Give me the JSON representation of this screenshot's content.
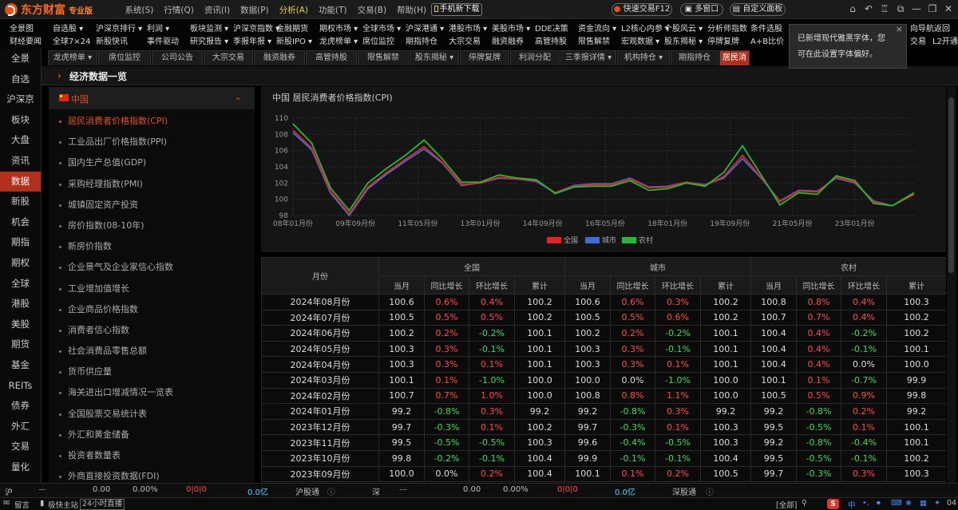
{
  "app": {
    "brand": "东方财富",
    "edition": "专业版"
  },
  "menu": [
    "系统(S)",
    "行情(Q)",
    "资讯(I)",
    "数据(P)",
    "分析(A)",
    "功能(T)",
    "交易(B)",
    "帮助(H)"
  ],
  "menu_active_index": 4,
  "toolbar": {
    "mobile_download": "手机新下载",
    "quick_trade": "快速交易F12",
    "multi_window": "多窗口",
    "custom_panel": "自定义面板"
  },
  "nav_row1": [
    "全景图",
    "自选股 ▾",
    "沪深京排行 ▾",
    "利润 ▾",
    "板块监测 ▾",
    "沪深京指数 ▾",
    "金融期货",
    "期权市场 ▾",
    "全球市场 ▾",
    "沪深港通 ▾",
    "港股市场 ▾",
    "美股市场 ▾",
    "DDE决策",
    "资金流向 ▾",
    "L2核心内参 ▾",
    "个股风云 ▾",
    "分析师指数",
    "条件选股",
    "向导航",
    "返回"
  ],
  "nav_row2": [
    "财经要闻",
    "全球7×24",
    "新股快讯",
    "事件驱动",
    "研究报告 ▾",
    "季报年报 ▾",
    "新股IPO ▾",
    "龙虎榜单 ▾",
    "席位监控",
    "期指持仓",
    "大宗交易",
    "融资融券",
    "高管持股",
    "限售解禁",
    "宏观数据 ▾",
    "股东揭秘 ▾",
    "停牌复牌",
    "A+B比价",
    "交易",
    "L2开通"
  ],
  "sidebar": [
    "全景",
    "自选",
    "沪深京",
    "板块",
    "大盘",
    "资讯",
    "数据",
    "新股",
    "机会",
    "期指",
    "期权",
    "全球",
    "港股",
    "美股",
    "期货",
    "基金",
    "REITs",
    "债券",
    "外汇",
    "交易",
    "量化"
  ],
  "sidebar_active_index": 6,
  "tabs": [
    "龙虎榜单 ▾",
    "席位监控",
    "公司公告",
    "大宗交易",
    "融资融券",
    "高管持股",
    "限售解禁",
    "股东揭秘 ▾",
    "停牌复牌",
    "利润分配",
    "三季报详情 ▾",
    "机构持仓 ▾",
    "期指持仓",
    "居民消"
  ],
  "tabs_active_index": 13,
  "section_title": "经济数据一览",
  "category": {
    "name": "中国"
  },
  "indicators": [
    "居民消费者价格指数(CPI)",
    "工业品出厂价格指数(PPI)",
    "国内生产总值(GDP)",
    "采购经理指数(PMI)",
    "城镇固定资产投资",
    "房价指数(08-10年)",
    "新房价指数",
    "企业景气及企业家信心指数",
    "工业增加值增长",
    "企业商品价格指数",
    "消费者信心指数",
    "社会消费品零售总额",
    "货币供应量",
    "海关进出口增减情况一览表",
    "全国股票交易统计表",
    "外汇和黄金储备",
    "投资者数量表",
    "外商直接投资数据(FDI)"
  ],
  "indicators_active_index": 0,
  "tooltip": {
    "line1": "已新增现代雅黑字体，您",
    "line2": "可在此设置字体偏好。"
  },
  "chart_data": {
    "type": "line",
    "title": "中国 居民消费者价格指数(CPI)",
    "x": [
      "2008-01",
      "2008-07",
      "2009-01",
      "2009-07",
      "2010-01",
      "2010-07",
      "2011-01",
      "2011-07",
      "2012-01",
      "2012-07",
      "2013-01",
      "2013-07",
      "2014-01",
      "2014-07",
      "2015-01",
      "2015-07",
      "2016-01",
      "2016-07",
      "2017-01",
      "2017-07",
      "2018-01",
      "2018-07",
      "2019-01",
      "2019-07",
      "2020-01",
      "2020-07",
      "2021-01",
      "2021-07",
      "2022-01",
      "2022-07",
      "2023-01",
      "2023-07",
      "2024-01",
      "2024-08"
    ],
    "xtick_labels": [
      "08年01月份",
      "09年09月份",
      "11年05月份",
      "13年01月份",
      "14年09月份",
      "16年05月份",
      "18年01月份",
      "19年09月份",
      "21年05月份",
      "23年01月份"
    ],
    "xtick_values": [
      "2008-01",
      "2009-09",
      "2011-05",
      "2013-01",
      "2014-09",
      "2016-05",
      "2018-01",
      "2019-09",
      "2021-05",
      "2023-01"
    ],
    "ylim": [
      98,
      110
    ],
    "yticks": [
      98,
      100,
      102,
      104,
      106,
      108,
      110
    ],
    "grid": true,
    "legend": "bottom",
    "series": [
      {
        "name": "全国",
        "color": "#e8202a",
        "values": [
          108.5,
          106.3,
          101.0,
          98.2,
          101.5,
          103.3,
          104.9,
          106.5,
          104.5,
          101.8,
          102.0,
          102.7,
          102.5,
          102.3,
          100.8,
          101.6,
          101.8,
          101.8,
          102.5,
          101.4,
          101.5,
          102.1,
          101.7,
          102.8,
          105.4,
          102.7,
          99.7,
          101.0,
          100.9,
          102.7,
          102.1,
          99.7,
          99.2,
          100.6
        ]
      },
      {
        "name": "城市",
        "color": "#3a6fd8",
        "values": [
          108.2,
          106.1,
          100.8,
          98.0,
          101.3,
          103.1,
          104.7,
          106.2,
          104.4,
          101.7,
          102.0,
          102.6,
          102.5,
          102.2,
          100.8,
          101.7,
          101.9,
          101.9,
          102.6,
          101.5,
          101.6,
          102.1,
          101.8,
          102.6,
          105.0,
          102.6,
          99.8,
          101.1,
          101.0,
          102.6,
          102.0,
          99.8,
          99.2,
          100.6
        ]
      },
      {
        "name": "农村",
        "color": "#22bb33",
        "values": [
          109.3,
          106.9,
          101.4,
          98.6,
          102.0,
          103.8,
          105.4,
          107.3,
          104.9,
          102.1,
          102.1,
          103.0,
          102.6,
          102.4,
          100.7,
          101.5,
          101.6,
          101.6,
          102.3,
          101.1,
          101.3,
          102.0,
          101.6,
          103.3,
          106.6,
          103.0,
          99.3,
          100.8,
          100.6,
          102.9,
          102.3,
          99.5,
          99.2,
          100.8
        ]
      }
    ]
  },
  "table": {
    "groups": [
      "全国",
      "城市",
      "农村"
    ],
    "month_header": "月份",
    "subcols": [
      "当月",
      "同比增长",
      "环比增长",
      "累计"
    ],
    "rows": [
      [
        "2024年08月份",
        "100.6",
        "0.6%",
        "0.4%",
        "100.2",
        "100.6",
        "0.6%",
        "0.3%",
        "100.2",
        "100.8",
        "0.8%",
        "0.4%",
        "100.3"
      ],
      [
        "2024年07月份",
        "100.5",
        "0.5%",
        "0.5%",
        "100.2",
        "100.5",
        "0.5%",
        "0.6%",
        "100.2",
        "100.7",
        "0.7%",
        "0.4%",
        "100.2"
      ],
      [
        "2024年06月份",
        "100.2",
        "0.2%",
        "-0.2%",
        "100.1",
        "100.2",
        "0.2%",
        "-0.2%",
        "100.1",
        "100.4",
        "0.4%",
        "-0.2%",
        "100.2"
      ],
      [
        "2024年05月份",
        "100.3",
        "0.3%",
        "-0.1%",
        "100.1",
        "100.3",
        "0.3%",
        "-0.1%",
        "100.1",
        "100.4",
        "0.4%",
        "-0.1%",
        "100.1"
      ],
      [
        "2024年04月份",
        "100.3",
        "0.3%",
        "0.1%",
        "100.1",
        "100.3",
        "0.3%",
        "0.1%",
        "100.1",
        "100.4",
        "0.4%",
        "0.0%",
        "100.0"
      ],
      [
        "2024年03月份",
        "100.1",
        "0.1%",
        "-1.0%",
        "100.0",
        "100.0",
        "0.0%",
        "-1.0%",
        "100.0",
        "100.1",
        "0.1%",
        "-0.7%",
        "99.9"
      ],
      [
        "2024年02月份",
        "100.7",
        "0.7%",
        "1.0%",
        "100.0",
        "100.8",
        "0.8%",
        "1.1%",
        "100.0",
        "100.5",
        "0.5%",
        "0.9%",
        "99.8"
      ],
      [
        "2024年01月份",
        "99.2",
        "-0.8%",
        "0.3%",
        "99.2",
        "99.2",
        "-0.8%",
        "0.3%",
        "99.2",
        "99.2",
        "-0.8%",
        "0.2%",
        "99.2"
      ],
      [
        "2023年12月份",
        "99.7",
        "-0.3%",
        "0.1%",
        "100.2",
        "99.7",
        "-0.3%",
        "0.1%",
        "100.3",
        "99.5",
        "-0.5%",
        "0.1%",
        "100.1"
      ],
      [
        "2023年11月份",
        "99.5",
        "-0.5%",
        "-0.5%",
        "100.3",
        "99.6",
        "-0.4%",
        "-0.5%",
        "100.3",
        "99.2",
        "-0.8%",
        "-0.4%",
        "100.1"
      ],
      [
        "2023年10月份",
        "99.8",
        "-0.2%",
        "-0.1%",
        "100.4",
        "99.9",
        "-0.1%",
        "-0.1%",
        "100.4",
        "99.5",
        "-0.5%",
        "-0.1%",
        "100.2"
      ],
      [
        "2023年09月份",
        "100.0",
        "0.0%",
        "0.2%",
        "100.4",
        "100.1",
        "0.1%",
        "0.2%",
        "100.5",
        "99.7",
        "-0.3%",
        "0.3%",
        "100.3"
      ]
    ]
  },
  "status": {
    "sh_label": "沪",
    "sh_dash": "—",
    "sh_val": "0.00",
    "sh_pct": "0.00%",
    "sh_cnt": "0|0|0",
    "sh_amt": "0.0亿",
    "hgt_label": "沪股通",
    "sz_label": "深",
    "sz_dash": "—",
    "sz_val": "0.00",
    "sz_pct": "0.00%",
    "sz_cnt": "0|0|0",
    "sz_amt": "0.0亿",
    "sgt_label": "深股通"
  },
  "bottom": {
    "msg": "留言",
    "fast_chat": "极快主站",
    "live": "24小时直播",
    "all": "[全部]",
    "sogou": "中",
    "num": "04"
  }
}
